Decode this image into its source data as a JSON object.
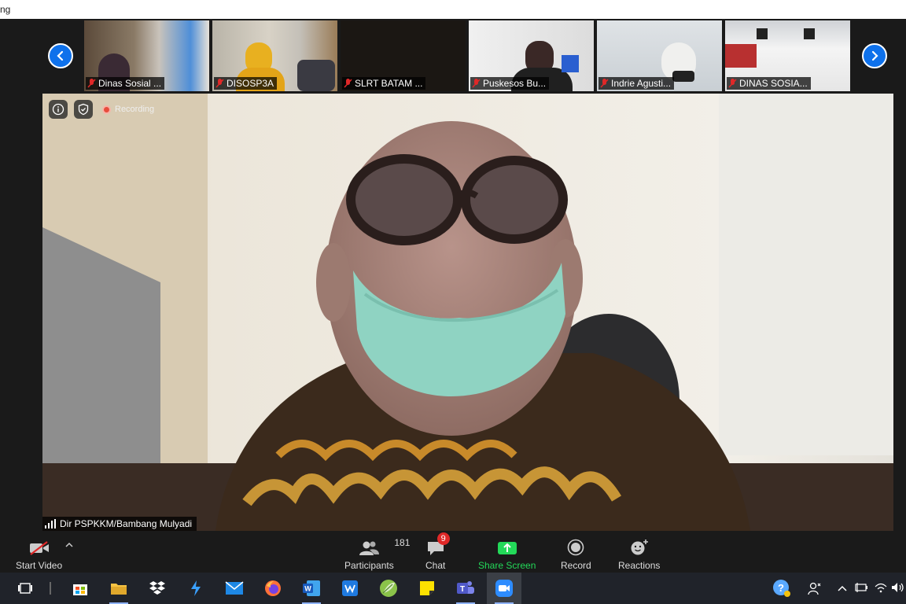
{
  "window": {
    "title": "ng"
  },
  "gallery": [
    {
      "name": "Dinas Sosial ..."
    },
    {
      "name": "DISOSP3A"
    },
    {
      "name": "SLRT BATAM ..."
    },
    {
      "name": "Puskesos Bu..."
    },
    {
      "name": "Indrie Agusti..."
    },
    {
      "name": "DINAS SOSIA..."
    }
  ],
  "main": {
    "recording_label": "Recording",
    "speaker_name": "Dir PSPKKM/Bambang Mulyadi"
  },
  "toolbar": {
    "start_video": "Start Video",
    "participants": "Participants",
    "participant_count": "181",
    "chat": "Chat",
    "chat_badge": "9",
    "share_screen": "Share Screen",
    "record": "Record",
    "reactions": "Reactions"
  },
  "colors": {
    "accent": "#0e71eb",
    "share": "#23d959",
    "badge": "#e02828"
  }
}
